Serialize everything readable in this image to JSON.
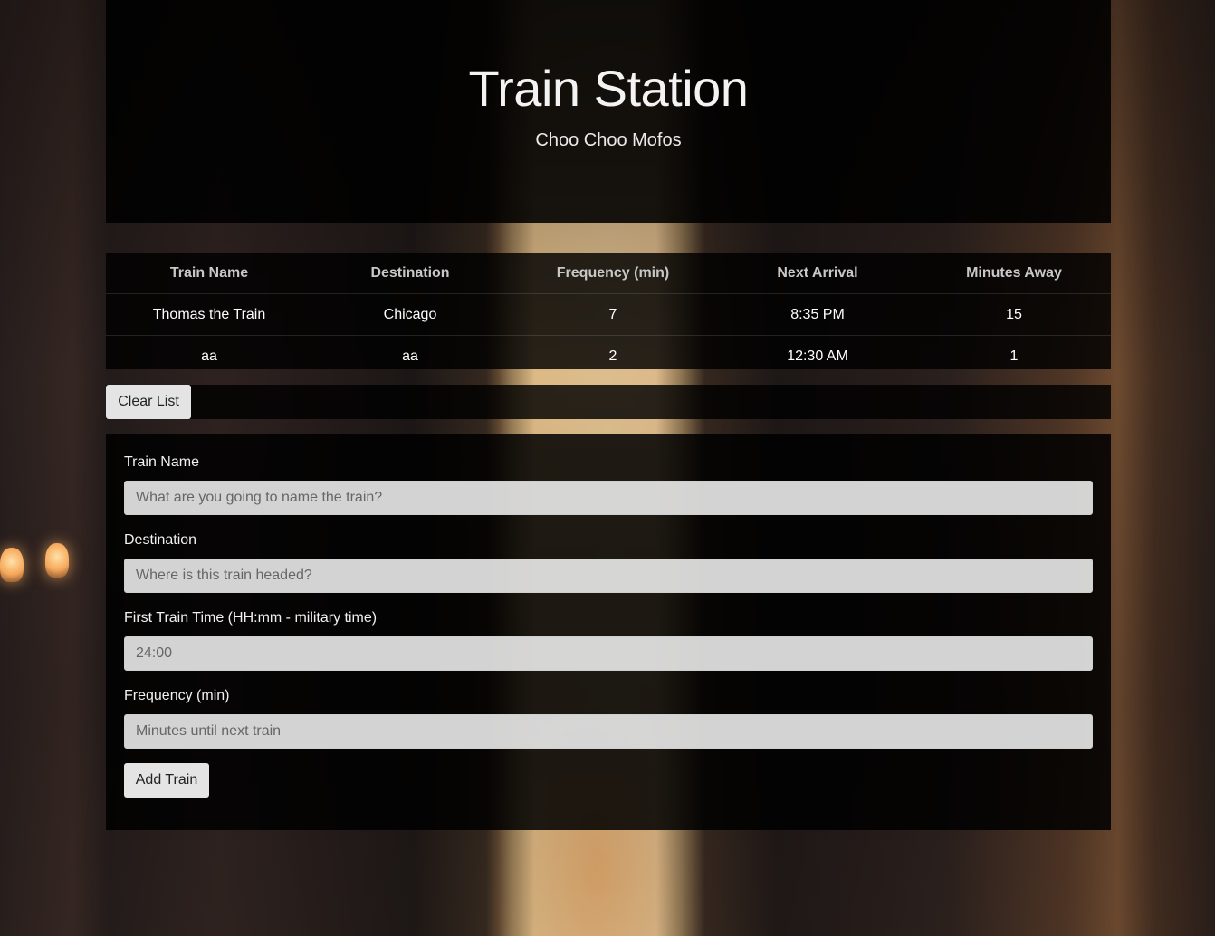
{
  "header": {
    "title": "Train Station",
    "subtitle": "Choo Choo Mofos"
  },
  "schedule": {
    "columns": [
      "Train Name",
      "Destination",
      "Frequency (min)",
      "Next Arrival",
      "Minutes Away"
    ],
    "rows": [
      [
        "Thomas the Train",
        "Chicago",
        "7",
        "8:35 PM",
        "15"
      ],
      [
        "aa",
        "aa",
        "2",
        "12:30 AM",
        "1"
      ]
    ]
  },
  "actions": {
    "clear_label": "Clear List",
    "add_label": "Add Train"
  },
  "form": {
    "train_name": {
      "label": "Train Name",
      "placeholder": "What are you going to name the train?",
      "value": ""
    },
    "destination": {
      "label": "Destination",
      "placeholder": "Where is this train headed?",
      "value": ""
    },
    "first_time": {
      "label": "First Train Time (HH:mm - military time)",
      "placeholder": "24:00",
      "value": ""
    },
    "frequency": {
      "label": "Frequency (min)",
      "placeholder": "Minutes until next train",
      "value": ""
    }
  }
}
